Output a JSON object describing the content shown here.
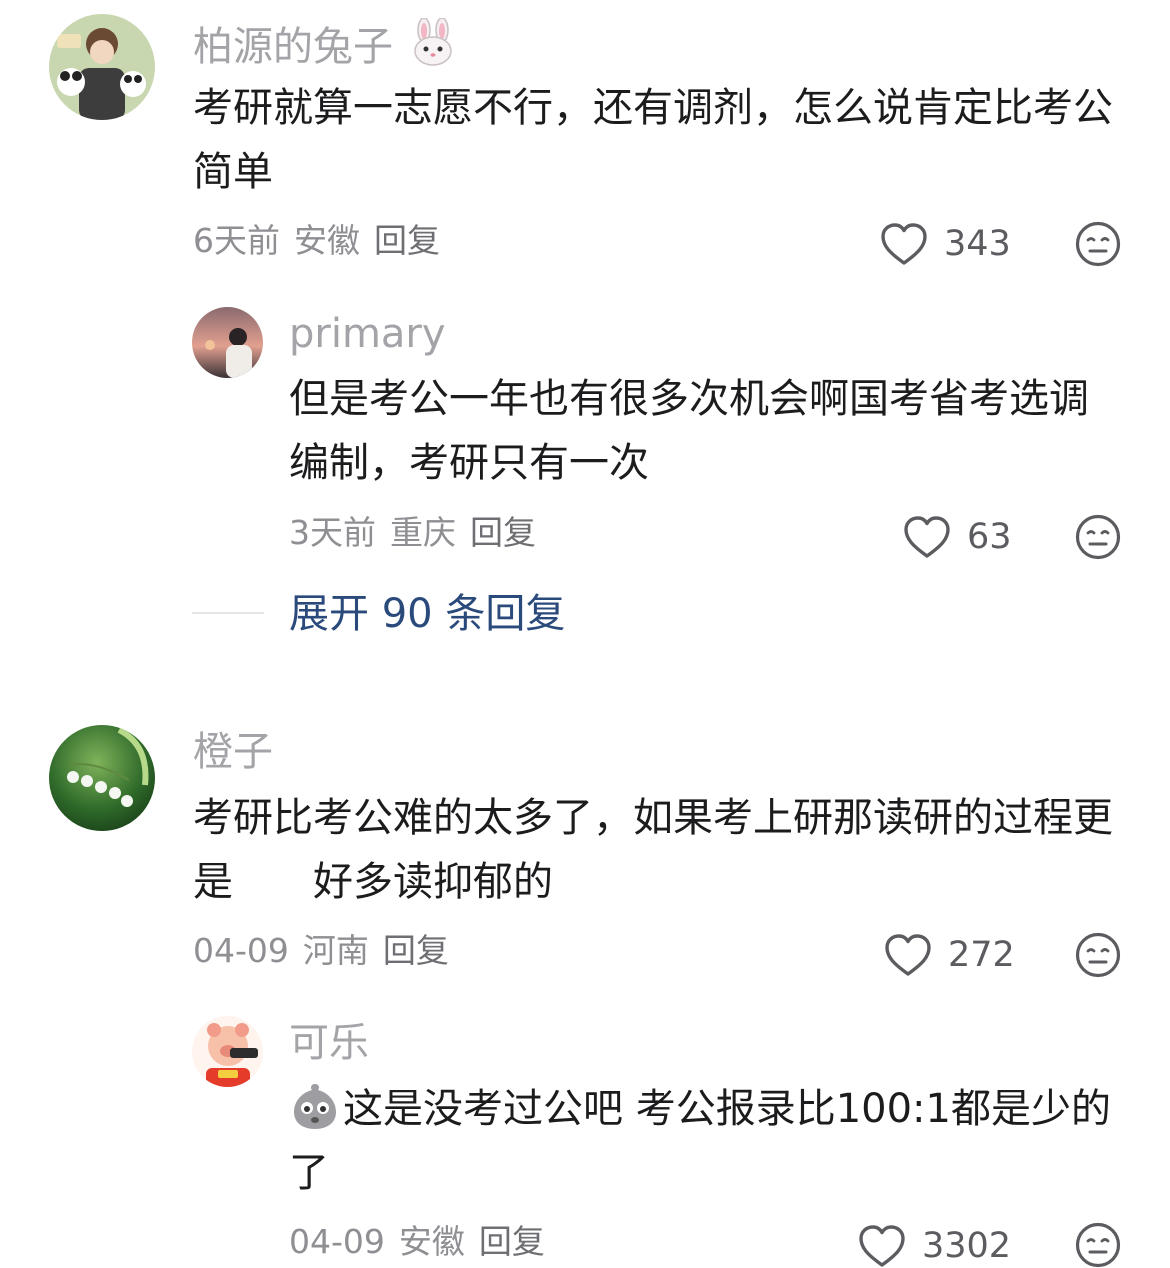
{
  "comments": [
    {
      "username": "柏源的兔子",
      "username_emoji": "rabbit-face-emoji",
      "text": "考研就算一志愿不行，还有调剂，怎么说肯定比考公简单",
      "time": "6天前",
      "location": "安徽",
      "reply_label": "回复",
      "likes": "343",
      "replies": [
        {
          "username": "primary",
          "text": "但是考公一年也有很多次机会啊国考省考选调编制，考研只有一次",
          "time": "3天前",
          "location": "重庆",
          "reply_label": "回复",
          "likes": "63"
        }
      ],
      "expand_label": "展开 90 条回复"
    },
    {
      "username": "橙子",
      "text": "考研比考公难的太多了，如果考上研那读研的过程更是　　好多读抑郁的",
      "time": "04-09",
      "location": "河南",
      "reply_label": "回复",
      "likes": "272",
      "replies": [
        {
          "username": "可乐",
          "text_emoji": "crying-face-emoji",
          "text": "这是没考过公吧 考公报录比100:1都是少的了",
          "time": "04-09",
          "location": "安徽",
          "reply_label": "回复",
          "likes": "3302"
        }
      ]
    }
  ],
  "icons": {
    "like": "heart-outline-icon",
    "dislike": "neutral-face-icon"
  },
  "colors": {
    "username": "#a4a4a8",
    "meta": "#8e8e93",
    "expand_link": "#2b4a7c",
    "text": "#1c1c1e"
  }
}
